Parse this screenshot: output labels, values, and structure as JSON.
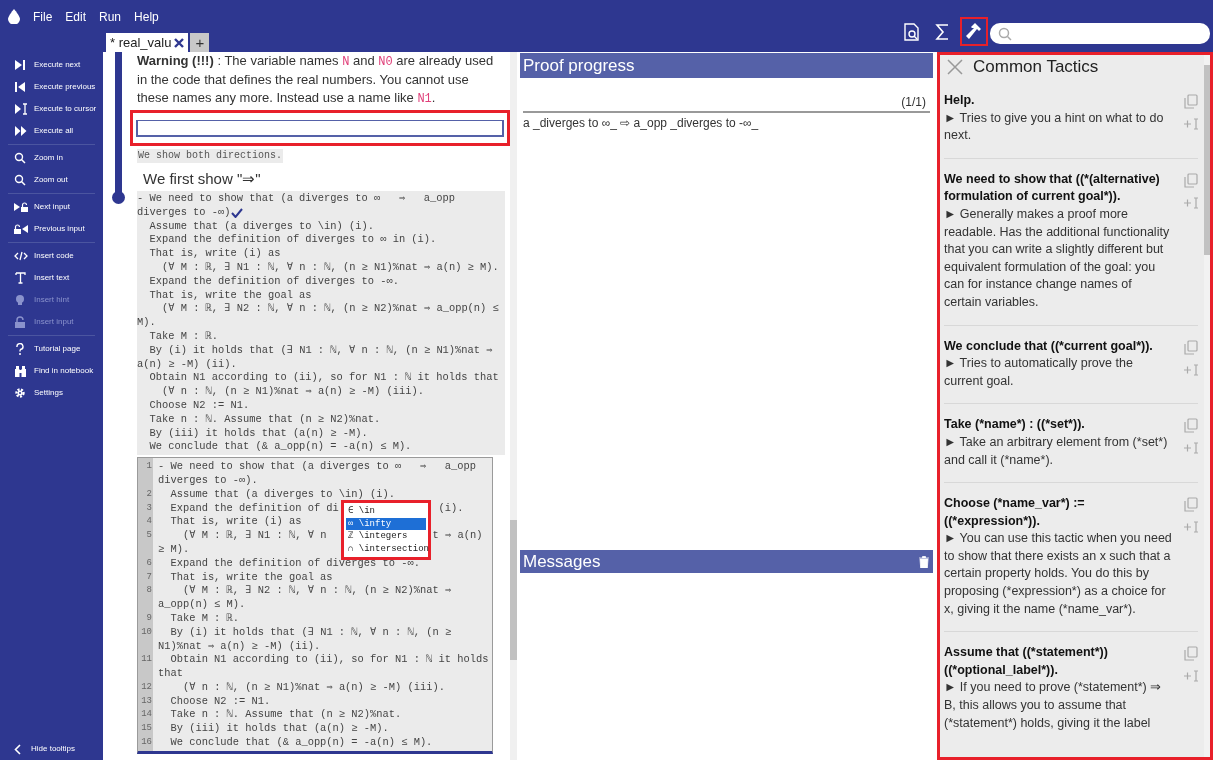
{
  "menu": [
    "File",
    "Edit",
    "Run",
    "Help"
  ],
  "tabs": [
    {
      "label": "* real_valu",
      "selected": true
    }
  ],
  "new_tab": "+",
  "toolbar": {
    "tools": [
      {
        "highlighted": false
      },
      {
        "highlighted": false
      },
      {
        "highlighted": true
      }
    ]
  },
  "sidebar": {
    "groups": [
      [
        {
          "label": "Execute next",
          "disabled": false
        },
        {
          "label": "Execute previous",
          "disabled": false
        },
        {
          "label": "Execute to cursor",
          "disabled": false
        },
        {
          "label": "Execute all",
          "disabled": false
        }
      ],
      [
        {
          "label": "Zoom in",
          "disabled": false
        },
        {
          "label": "Zoom out",
          "disabled": false
        }
      ],
      [
        {
          "label": "Next input",
          "disabled": false
        },
        {
          "label": "Previous input",
          "disabled": false
        }
      ],
      [
        {
          "label": "Insert code",
          "disabled": false
        },
        {
          "label": "Insert text",
          "disabled": false
        },
        {
          "label": "Insert hint",
          "disabled": true
        },
        {
          "label": "Insert input",
          "disabled": true
        }
      ],
      [
        {
          "label": "Tutorial page",
          "disabled": false
        },
        {
          "label": "Find in notebook",
          "disabled": false
        },
        {
          "label": "Settings",
          "disabled": false
        }
      ]
    ],
    "footer": "Hide tooltips"
  },
  "notebook": {
    "cells": [
      {
        "kind": "text",
        "parts": [
          {
            "kind": "bold",
            "text": "Warning (!!!)"
          },
          {
            "kind": "plain",
            "text": " : The variable names "
          },
          {
            "kind": "name",
            "text": "N"
          },
          {
            "kind": "plain",
            "text": " and "
          },
          {
            "kind": "name",
            "text": "N0"
          },
          {
            "kind": "plain",
            "text": " are already used in the code that defines the real numbers. You cannot use these names any more. Instead use a name like "
          },
          {
            "kind": "name",
            "text": "N1"
          },
          {
            "kind": "plain",
            "text": "."
          }
        ]
      },
      {
        "kind": "input",
        "highlighted": true
      },
      {
        "kind": "code_text",
        "text": "We show both directions."
      },
      {
        "kind": "heading",
        "text": "We first show \"⇒\""
      },
      {
        "kind": "code",
        "verified": true,
        "lines": [
          "- We need to show that (a diverges to ∞   ⇒   a_opp",
          "diverges to -∞)",
          "  Assume that (a diverges to \\in) (i).",
          "  Expand the definition of diverges to ∞ in (i).",
          "  That is, write (i) as",
          "    (∀ M : ℝ, ∃ N1 : ℕ, ∀ n : ℕ, (n ≥ N1)%nat ⇒ a(n) ≥ M).",
          "  Expand the definition of diverges to -∞.",
          "  That is, write the goal as",
          "    (∀ M : ℝ, ∃ N2 : ℕ, ∀ n : ℕ, (n ≥ N2)%nat ⇒ a_opp(n) ≤",
          "M).",
          "  Take M : ℝ.",
          "  By (i) it holds that (∃ N1 : ℕ, ∀ n : ℕ, (n ≥ N1)%nat ⇒",
          "a(n) ≥ -M) (ii).",
          "  Obtain N1 according to (ii), so for N1 : ℕ it holds that",
          "    (∀ n : ℕ, (n ≥ N1)%nat ⇒ a(n) ≥ -M) (iii).",
          "  Choose N2 := N1.",
          "  Take n : ℕ. Assume that (n ≥ N2)%nat.",
          "  By (iii) it holds that (a(n) ≥ -M).",
          "  We conclude that (& a_opp(n) = -a(n) ≤ M)."
        ]
      },
      {
        "kind": "editor",
        "lines": [
          {
            "number": "1",
            "text": "- We need to show that (a diverges to ∞   ⇒   a_opp"
          },
          {
            "text": "diverges to -∞)."
          },
          {
            "number": "2",
            "text": "  Assume that (a diverges to \\in) (i)."
          },
          {
            "number": "3",
            "text": "  Expand the definition of di                (i)."
          },
          {
            "number": "4",
            "text": "  That is, write (i) as"
          },
          {
            "number": "5",
            "text": "    (∀ M : ℝ, ∃ N1 : ℕ, ∀ n                 t ⇒ a(n)"
          },
          {
            "text": "≥ M)."
          },
          {
            "number": "6",
            "text": "  Expand the definition of diverges to -∞."
          },
          {
            "number": "7",
            "text": "  That is, write the goal as"
          },
          {
            "number": "8",
            "text": "    (∀ M : ℝ, ∃ N2 : ℕ, ∀ n : ℕ, (n ≥ N2)%nat ⇒"
          },
          {
            "text": "a_opp(n) ≤ M)."
          },
          {
            "number": "9",
            "text": "  Take M : ℝ."
          },
          {
            "number": "10",
            "text": "  By (i) it holds that (∃ N1 : ℕ, ∀ n : ℕ, (n ≥"
          },
          {
            "text": "N1)%nat ⇒ a(n) ≥ -M) (ii)."
          },
          {
            "number": "11",
            "text": "  Obtain N1 according to (ii), so for N1 : ℕ it holds"
          },
          {
            "text": "that"
          },
          {
            "number": "12",
            "text": "    (∀ n : ℕ, (n ≥ N1)%nat ⇒ a(n) ≥ -M) (iii)."
          },
          {
            "number": "13",
            "text": "  Choose N2 := N1."
          },
          {
            "number": "14",
            "text": "  Take n : ℕ. Assume that (n ≥ N2)%nat."
          },
          {
            "number": "15",
            "text": "  By (iii) it holds that (a(n) ≥ -M)."
          },
          {
            "number": "16",
            "text": "  We conclude that (& a_opp(n) = -a(n) ≤ M)."
          }
        ],
        "autocomplete": {
          "highlighted": true,
          "items": [
            {
              "text": "∈ \\in",
              "selected": false
            },
            {
              "text": "∞ \\infty",
              "selected": true
            },
            {
              "text": "ℤ \\integers",
              "selected": false
            },
            {
              "text": "∩ \\intersection",
              "selected": false
            }
          ]
        }
      }
    ]
  },
  "proof_progress": {
    "title": "Proof progress",
    "counter": "(1/1)",
    "goal": "a _diverges to ∞_ ⇨ a_opp _diverges to -∞_"
  },
  "messages": {
    "title": "Messages"
  },
  "tactics": {
    "title": "Common Tactics",
    "highlighted": true,
    "items": [
      {
        "title": "Help.",
        "description": "► Tries to give you a hint on what to do next."
      },
      {
        "title": "We need to show that ((*(alternative) formulation of current goal*)).",
        "description": "► Generally makes a proof more readable. Has the additional functionality that you can write a slightly different but equivalent formulation of the goal: you can for instance change names of certain variables."
      },
      {
        "title": "We conclude that ((*current goal*)).",
        "description": "► Tries to automatically prove the current goal."
      },
      {
        "title": "Take (*name*) : ((*set*)).",
        "description": "► Take an arbitrary element from (*set*) and call it (*name*)."
      },
      {
        "title": "Choose (*name_var*) := ((*expression*)).",
        "description": "► You can use this tactic when you need to show that there exists an x such that a certain property holds. You do this by proposing (*expression*) as a choice for x, giving it the name (*name_var*)."
      },
      {
        "title": "Assume that ((*statement*)) ((*optional_label*)).",
        "description": "► If you need to prove (*statement*) ⇒ B, this allows you to assume that (*statement*) holds, giving it the label"
      }
    ]
  }
}
